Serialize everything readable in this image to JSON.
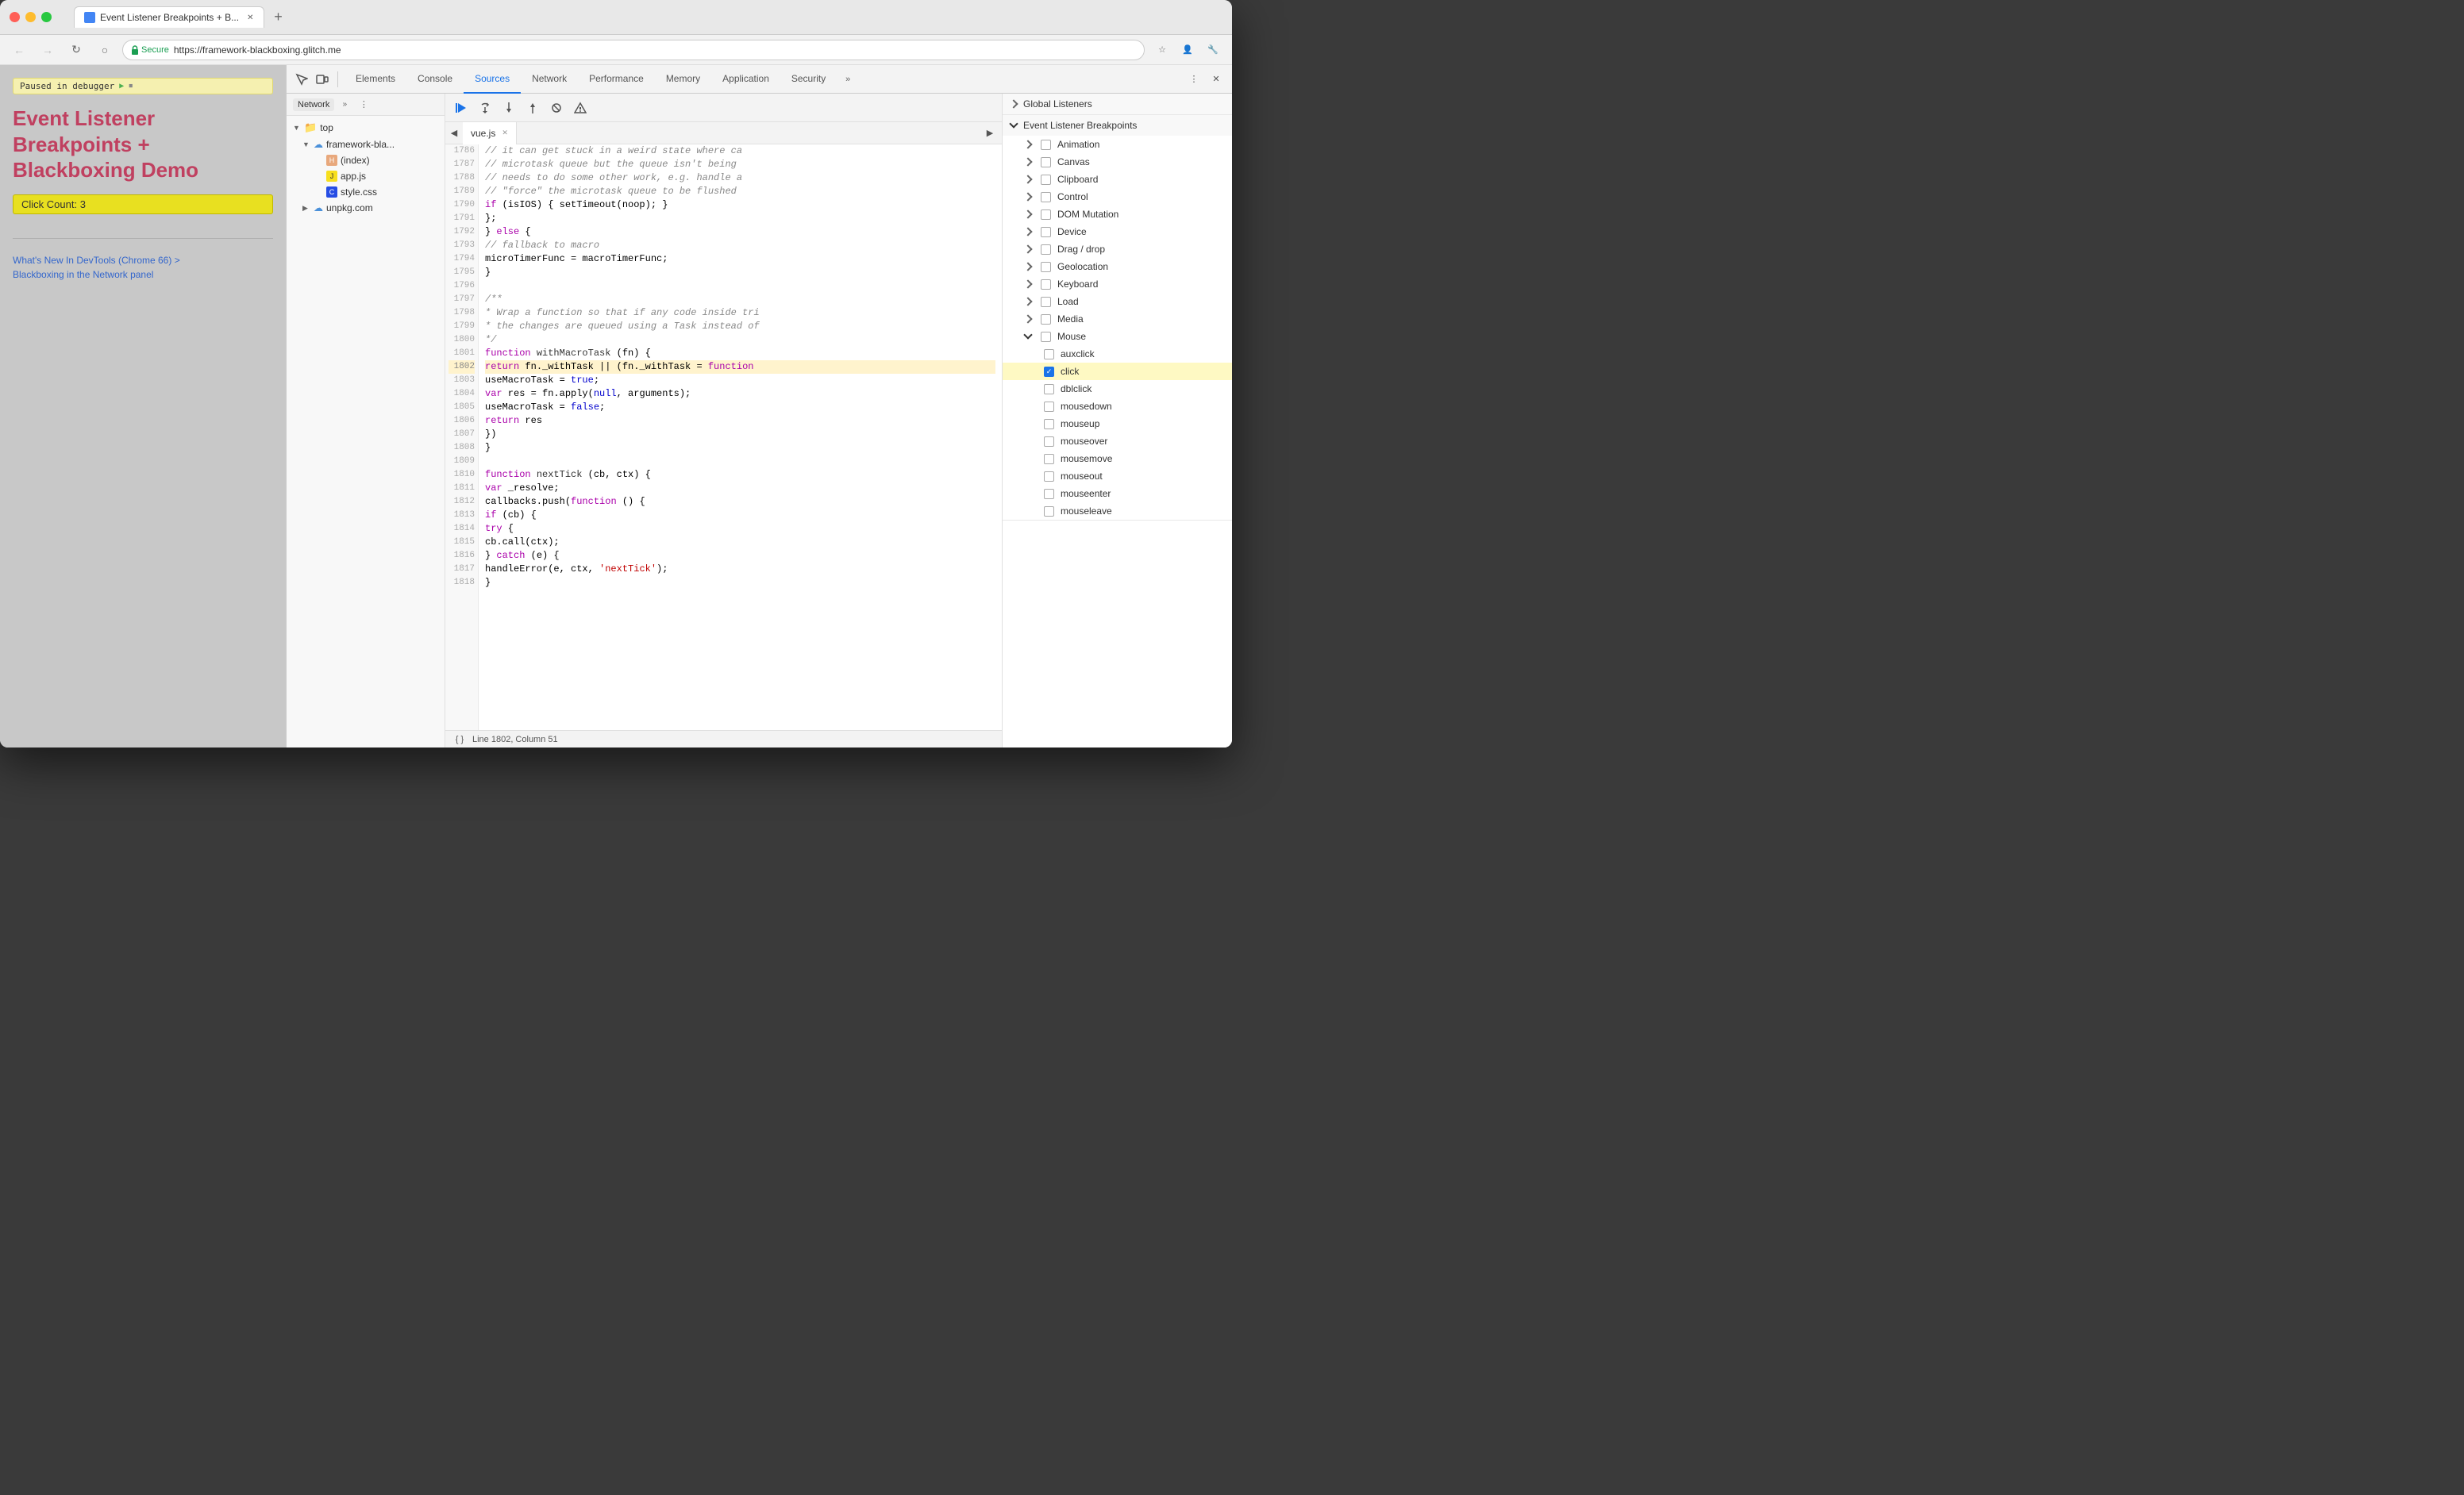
{
  "browser": {
    "title": "Event Listener Breakpoints + B...",
    "url": "https://framework-blackboxing.glitch.me",
    "url_display": "https://framework-blackboxing.glitch.me",
    "secure_label": "Secure"
  },
  "tabs": [
    {
      "id": "sources",
      "label": "Sources"
    },
    {
      "id": "network",
      "label": "Network"
    },
    {
      "id": "performance",
      "label": "Performance"
    },
    {
      "id": "memory",
      "label": "Memory"
    },
    {
      "id": "application",
      "label": "Application"
    },
    {
      "id": "security",
      "label": "Security"
    }
  ],
  "devtools_tabs": [
    {
      "id": "elements",
      "label": "Elements"
    },
    {
      "id": "console",
      "label": "Console"
    },
    {
      "id": "sources",
      "label": "Sources",
      "active": true
    },
    {
      "id": "network",
      "label": "Network"
    },
    {
      "id": "performance",
      "label": "Performance"
    },
    {
      "id": "memory",
      "label": "Memory"
    },
    {
      "id": "application",
      "label": "Application"
    },
    {
      "id": "security",
      "label": "Security"
    }
  ],
  "page": {
    "paused_label": "Paused in debugger",
    "title_line1": "Event Listener",
    "title_line2": "Breakpoints +",
    "title_line3": "Blackboxing Demo",
    "click_count_label": "Click Count: 3",
    "link1": "What's New In DevTools (Chrome 66) >",
    "link2": "Blackboxing in the Network panel"
  },
  "sources_panel": {
    "tab_network": "Network",
    "file_tree": [
      {
        "indent": 0,
        "type": "folder",
        "name": "top",
        "expanded": true
      },
      {
        "indent": 1,
        "type": "folder",
        "name": "framework-bla...",
        "expanded": true,
        "cloud": true
      },
      {
        "indent": 2,
        "type": "file",
        "name": "(index)",
        "filetype": "html"
      },
      {
        "indent": 2,
        "type": "file",
        "name": "app.js",
        "filetype": "js"
      },
      {
        "indent": 2,
        "type": "file",
        "name": "style.css",
        "filetype": "css"
      },
      {
        "indent": 1,
        "type": "folder",
        "name": "unpkg.com",
        "expanded": false,
        "cloud": true
      }
    ]
  },
  "code_editor": {
    "file_name": "vue.js",
    "lines": [
      {
        "num": 1786,
        "text": "  // it can get stuck in a weird state where ca",
        "type": "comment"
      },
      {
        "num": 1787,
        "text": "  // microtask queue but the queue isn't being",
        "type": "comment"
      },
      {
        "num": 1788,
        "text": "  // needs to do some other work, e.g. handle a",
        "type": "comment"
      },
      {
        "num": 1789,
        "text": "  // \"force\" the microtask queue to be flushed",
        "type": "comment"
      },
      {
        "num": 1790,
        "text": "  if (isIOS) { setTimeout(noop); }",
        "type": "code"
      },
      {
        "num": 1791,
        "text": "};",
        "type": "code"
      },
      {
        "num": 1792,
        "text": "} else {",
        "type": "code"
      },
      {
        "num": 1793,
        "text": "  // fallback to macro",
        "type": "comment"
      },
      {
        "num": 1794,
        "text": "  microTimerFunc = macroTimerFunc;",
        "type": "code"
      },
      {
        "num": 1795,
        "text": "}",
        "type": "code"
      },
      {
        "num": 1796,
        "text": "",
        "type": "code"
      },
      {
        "num": 1797,
        "text": "/**",
        "type": "comment"
      },
      {
        "num": 1798,
        "text": " * Wrap a function so that if any code inside tri",
        "type": "comment"
      },
      {
        "num": 1799,
        "text": " * the changes are queued using a Task instead of",
        "type": "comment"
      },
      {
        "num": 1800,
        "text": " */",
        "type": "comment"
      },
      {
        "num": 1801,
        "text": "function withMacroTask (fn) {",
        "type": "code"
      },
      {
        "num": 1802,
        "text": "  return fn._withTask || (fn._withTask = function",
        "type": "code",
        "highlight": true
      },
      {
        "num": 1803,
        "text": "    useMacroTask = true;",
        "type": "code"
      },
      {
        "num": 1804,
        "text": "    var res = fn.apply(null, arguments);",
        "type": "code"
      },
      {
        "num": 1805,
        "text": "    useMacroTask = false;",
        "type": "code"
      },
      {
        "num": 1806,
        "text": "    return res",
        "type": "code"
      },
      {
        "num": 1807,
        "text": "  })",
        "type": "code"
      },
      {
        "num": 1808,
        "text": "}",
        "type": "code"
      },
      {
        "num": 1809,
        "text": "",
        "type": "code"
      },
      {
        "num": 1810,
        "text": "function nextTick (cb, ctx) {",
        "type": "code"
      },
      {
        "num": 1811,
        "text": "  var _resolve;",
        "type": "code"
      },
      {
        "num": 1812,
        "text": "  callbacks.push(function () {",
        "type": "code"
      },
      {
        "num": 1813,
        "text": "    if (cb) {",
        "type": "code"
      },
      {
        "num": 1814,
        "text": "      try {",
        "type": "code"
      },
      {
        "num": 1815,
        "text": "        cb.call(ctx);",
        "type": "code"
      },
      {
        "num": 1816,
        "text": "      } catch (e) {",
        "type": "code"
      },
      {
        "num": 1817,
        "text": "        handleError(e, ctx, 'nextTick');",
        "type": "code"
      },
      {
        "num": 1818,
        "text": "      }",
        "type": "code"
      }
    ],
    "status_bar": "Line 1802, Column 51"
  },
  "breakpoints": {
    "global_listeners_label": "Global Listeners",
    "event_listener_label": "Event Listener Breakpoints",
    "categories": [
      {
        "id": "animation",
        "label": "Animation",
        "expanded": false
      },
      {
        "id": "canvas",
        "label": "Canvas",
        "expanded": false
      },
      {
        "id": "clipboard",
        "label": "Clipboard",
        "expanded": false
      },
      {
        "id": "control",
        "label": "Control",
        "expanded": false
      },
      {
        "id": "dom-mutation",
        "label": "DOM Mutation",
        "expanded": false
      },
      {
        "id": "device",
        "label": "Device",
        "expanded": false
      },
      {
        "id": "drag-drop",
        "label": "Drag / drop",
        "expanded": false
      },
      {
        "id": "geolocation",
        "label": "Geolocation",
        "expanded": false
      },
      {
        "id": "keyboard",
        "label": "Keyboard",
        "expanded": false
      },
      {
        "id": "load",
        "label": "Load",
        "expanded": false
      },
      {
        "id": "media",
        "label": "Media",
        "expanded": false
      },
      {
        "id": "mouse",
        "label": "Mouse",
        "expanded": true
      }
    ],
    "mouse_events": [
      {
        "id": "auxclick",
        "label": "auxclick",
        "checked": false
      },
      {
        "id": "click",
        "label": "click",
        "checked": true,
        "highlighted": true
      },
      {
        "id": "dblclick",
        "label": "dblclick",
        "checked": false
      },
      {
        "id": "mousedown",
        "label": "mousedown",
        "checked": false
      },
      {
        "id": "mouseup",
        "label": "mouseup",
        "checked": false
      },
      {
        "id": "mouseover",
        "label": "mouseover",
        "checked": false
      },
      {
        "id": "mousemove",
        "label": "mousemove",
        "checked": false
      },
      {
        "id": "mouseout",
        "label": "mouseout",
        "checked": false
      },
      {
        "id": "mouseenter",
        "label": "mouseenter",
        "checked": false
      },
      {
        "id": "mouseleave",
        "label": "mouseleave",
        "checked": false
      }
    ]
  }
}
